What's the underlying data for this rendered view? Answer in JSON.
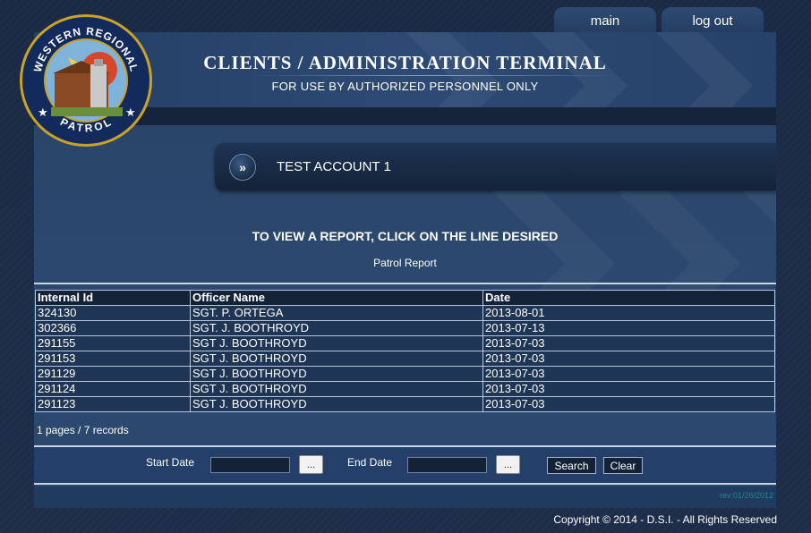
{
  "nav": {
    "main_label": "main",
    "logout_label": "log out"
  },
  "header": {
    "title": "CLIENTS / ADMINISTRATION TERMINAL",
    "subtitle": "FOR USE BY AUTHORIZED PERSONNEL ONLY"
  },
  "logo": {
    "top_text": "WESTERN REGIONAL",
    "bottom_text": "PATROL"
  },
  "account": {
    "icon": "double-chevron-right-icon",
    "name": "TEST ACCOUNT 1"
  },
  "instructions": "TO VIEW A REPORT, CLICK ON THE LINE DESIRED",
  "report_name": "Patrol Report",
  "table": {
    "columns": [
      "Internal Id",
      "Officer Name",
      "Date"
    ],
    "rows": [
      [
        "324130",
        "SGT. P. ORTEGA",
        "2013-08-01"
      ],
      [
        "302366",
        "SGT. J. BOOTHROYD",
        "2013-07-13"
      ],
      [
        "291155",
        "SGT J. BOOTHROYD",
        "2013-07-03"
      ],
      [
        "291153",
        "SGT J. BOOTHROYD",
        "2013-07-03"
      ],
      [
        "291129",
        "SGT J. BOOTHROYD",
        "2013-07-03"
      ],
      [
        "291124",
        "SGT J. BOOTHROYD",
        "2013-07-03"
      ],
      [
        "291123",
        "SGT J. BOOTHROYD",
        "2013-07-03"
      ]
    ]
  },
  "pager": "1 pages / 7 records",
  "search": {
    "start_label": "Start Date",
    "end_label": "End Date",
    "picker_label": "...",
    "search_label": "Search",
    "clear_label": "Clear",
    "start_value": "",
    "end_value": ""
  },
  "revision": "rev:01/26/2012",
  "copyright": "Copyright © 2014 - D.S.I. - All Rights Reserved",
  "colors": {
    "accent": "#2c4a72",
    "dark": "#142238",
    "rev": "#1f8a8a"
  }
}
